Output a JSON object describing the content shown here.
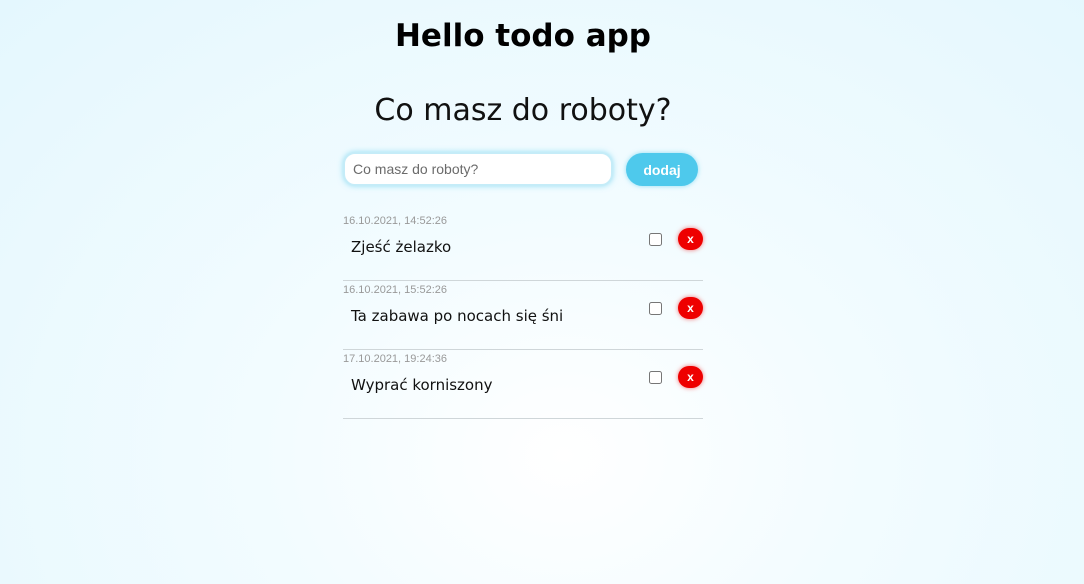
{
  "header": {
    "title": "Hello todo app",
    "subtitle": "Co masz do roboty?"
  },
  "form": {
    "input_value": "",
    "input_placeholder": "Co masz do roboty?",
    "add_label": "dodaj"
  },
  "todos": [
    {
      "date": "16.10.2021, 14:52:26",
      "text": "Zjeść żelazko",
      "done": false,
      "delete_label": "x"
    },
    {
      "date": "16.10.2021, 15:52:26",
      "text": "Ta zabawa po nocach się śni",
      "done": false,
      "delete_label": "x"
    },
    {
      "date": "17.10.2021, 19:24:36",
      "text": "Wyprać korniszony",
      "done": false,
      "delete_label": "x"
    }
  ],
  "colors": {
    "accent": "#4ec9ec",
    "delete": "#ee0000",
    "date_text": "#999999"
  }
}
